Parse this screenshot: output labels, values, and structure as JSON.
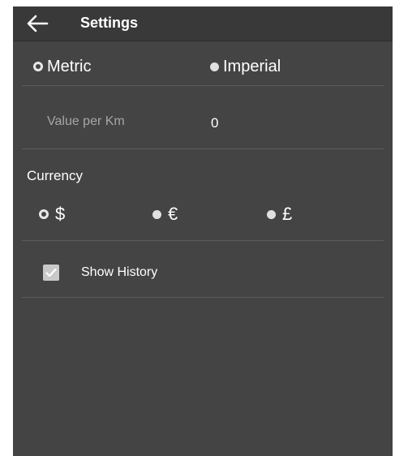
{
  "app_bar": {
    "title": "Settings",
    "back_icon": "arrow-left-icon"
  },
  "units": {
    "options": [
      {
        "label": "Metric",
        "selected": true
      },
      {
        "label": "Imperial",
        "selected": false
      }
    ]
  },
  "value_per_km": {
    "label": "Value per Km",
    "value": "0"
  },
  "currency": {
    "title": "Currency",
    "options": [
      {
        "label": "$",
        "selected": true
      },
      {
        "label": "€",
        "selected": false
      },
      {
        "label": "£",
        "selected": false
      }
    ]
  },
  "show_history": {
    "label": "Show History",
    "checked": true,
    "check_icon": "check-icon"
  },
  "colors": {
    "background": "#444444",
    "app_bar": "#393939",
    "text": "#ffffff",
    "muted_text": "#a6a6a6",
    "divider": "#5c5c5c",
    "checkbox": "#c9c9c9"
  }
}
